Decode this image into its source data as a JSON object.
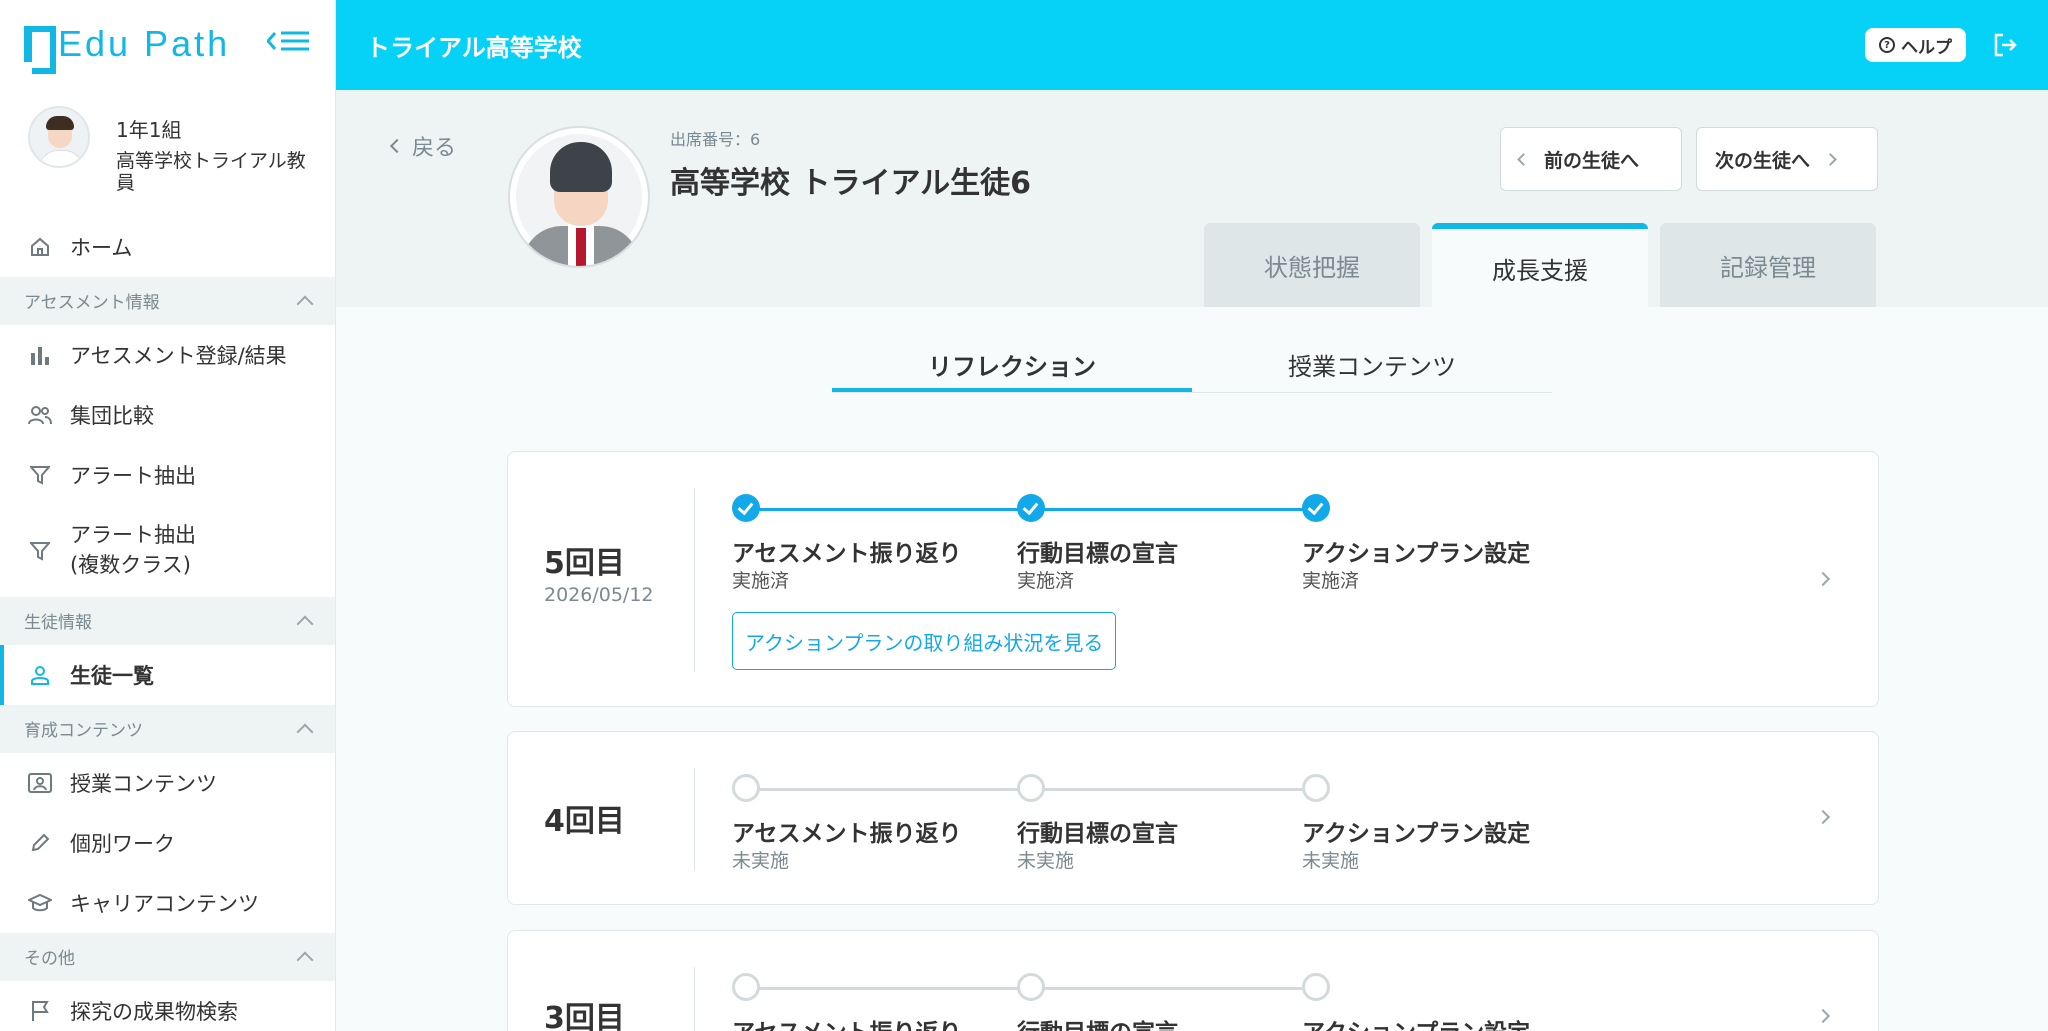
{
  "app": {
    "logo": "Edu Path",
    "school": "トライアル高等学校",
    "help_label": "ヘルプ"
  },
  "colors": {
    "accent": "#06d2f8",
    "primary": "#11a9ea"
  },
  "user": {
    "class": "1年1組",
    "role": "高等学校トライアル教員"
  },
  "sidebar": {
    "home": "ホーム",
    "sections": [
      {
        "title": "アセスメント情報",
        "items": [
          "アセスメント登録/結果",
          "集団比較",
          "アラート抽出",
          "アラート抽出\n(複数クラス)"
        ]
      },
      {
        "title": "生徒情報",
        "items": [
          "生徒一覧"
        ]
      },
      {
        "title": "育成コンテンツ",
        "items": [
          "授業コンテンツ",
          "個別ワーク",
          "キャリアコンテンツ"
        ]
      },
      {
        "title": "その他",
        "items": [
          "探究の成果物検索"
        ]
      }
    ]
  },
  "student": {
    "back_label": "戻る",
    "attendance_no": "出席番号：6",
    "name": "高等学校 トライアル生徒6",
    "prev_label": "前の生徒へ",
    "next_label": "次の生徒へ"
  },
  "main_tabs": [
    "状態把握",
    "成長支援",
    "記録管理"
  ],
  "sub_tabs": [
    "リフレクション",
    "授業コンテンツ"
  ],
  "steps": [
    "アセスメント振り返り",
    "行動目標の宣言",
    "アクションプラン設定"
  ],
  "reflections": [
    {
      "round": "5回目",
      "date": "2026/05/12",
      "statuses": [
        "実施済",
        "実施済",
        "実施済"
      ],
      "link": "アクションプランの取り組み状況を見る"
    },
    {
      "round": "4回目",
      "date": "",
      "statuses": [
        "未実施",
        "未実施",
        "未実施"
      ]
    },
    {
      "round": "3回目",
      "date": "",
      "statuses": [
        "",
        "",
        ""
      ]
    }
  ]
}
